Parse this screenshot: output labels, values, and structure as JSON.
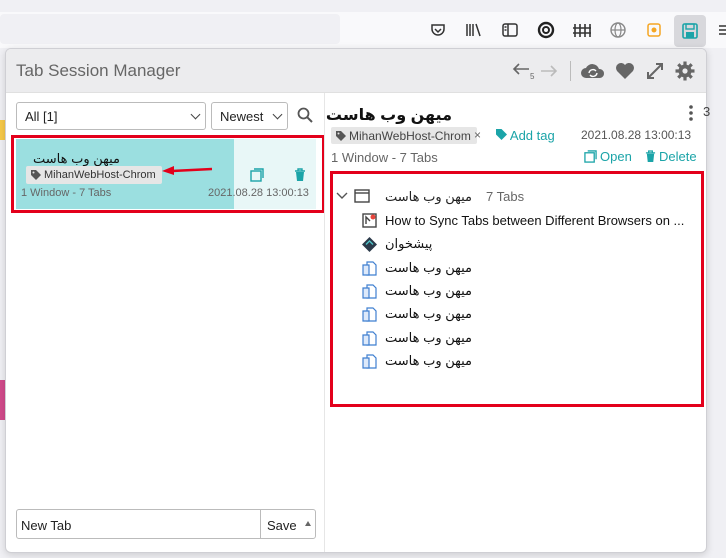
{
  "popup": {
    "title": "Tab Session Manager",
    "filter": {
      "selected": "All [1]"
    },
    "sort": {
      "selected": "Newest"
    },
    "session": {
      "name": "میهن وب هاست",
      "tag": "MihanWebHost-Chrom",
      "meta": "1 Window - 7 Tabs",
      "date": "2021.08.28 13:00:13"
    },
    "new_session": {
      "value": "New Tab",
      "save_label": "Save"
    }
  },
  "detail": {
    "title": "میهن وب هاست",
    "tag": "MihanWebHost-Chrom",
    "tag_remove": "×",
    "add_tag": "Add tag",
    "date": "2021.08.28 13:00:13",
    "meta": "1 Window - 7 Tabs",
    "open_label": "Open",
    "delete_label": "Delete",
    "window": {
      "name": "میهن وب هاست",
      "count": "7 Tabs"
    },
    "tabs": [
      {
        "title": "How to Sync Tabs between Different Browsers on ...",
        "favicon": "site-favicon"
      },
      {
        "title": "پیشخوان",
        "favicon": "dashboard-favicon"
      },
      {
        "title": "میهن وب هاست",
        "favicon": "generic-page-icon"
      },
      {
        "title": "میهن وب هاست",
        "favicon": "generic-page-icon"
      },
      {
        "title": "میهن وب هاست",
        "favicon": "generic-page-icon"
      },
      {
        "title": "میهن وب هاست",
        "favicon": "generic-page-icon"
      },
      {
        "title": "میهن وب هاست",
        "favicon": "generic-page-icon"
      }
    ]
  },
  "peek_text": "3",
  "colors": {
    "accent": "#1ba4a8",
    "highlight": "#9bdfe0",
    "annotation": "#e3001b"
  }
}
